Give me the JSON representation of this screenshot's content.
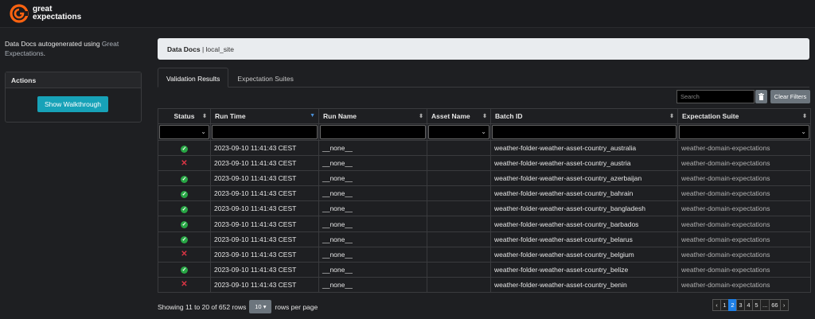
{
  "app": {
    "brand_line1": "great",
    "brand_line2": "expectations"
  },
  "sidebar": {
    "intro_text": "Data Docs autogenerated using ",
    "intro_link": "Great Expectations",
    "intro_end": ".",
    "actions_title": "Actions",
    "walkthrough_button": "Show Walkthrough"
  },
  "breadcrumb": {
    "root": "Data Docs",
    "separator": " | ",
    "site": "local_site"
  },
  "tabs": [
    {
      "label": "Validation Results",
      "active": true
    },
    {
      "label": "Expectation Suites",
      "active": false
    }
  ],
  "toolbar": {
    "search_placeholder": "Search",
    "clear_filters": "Clear Filters"
  },
  "table": {
    "columns": [
      "Status",
      "Run Time",
      "Run Name",
      "Asset Name",
      "Batch ID",
      "Expectation Suite"
    ],
    "rows": [
      {
        "status": "success",
        "run_time": "2023-09-10 11:41:43 CEST",
        "run_name": "__none__",
        "asset_name": "",
        "batch_id": "weather-folder-weather-asset-country_australia",
        "suite": "weather-domain-expectations"
      },
      {
        "status": "failed",
        "run_time": "2023-09-10 11:41:43 CEST",
        "run_name": "__none__",
        "asset_name": "",
        "batch_id": "weather-folder-weather-asset-country_austria",
        "suite": "weather-domain-expectations"
      },
      {
        "status": "success",
        "run_time": "2023-09-10 11:41:43 CEST",
        "run_name": "__none__",
        "asset_name": "",
        "batch_id": "weather-folder-weather-asset-country_azerbaijan",
        "suite": "weather-domain-expectations"
      },
      {
        "status": "success",
        "run_time": "2023-09-10 11:41:43 CEST",
        "run_name": "__none__",
        "asset_name": "",
        "batch_id": "weather-folder-weather-asset-country_bahrain",
        "suite": "weather-domain-expectations"
      },
      {
        "status": "success",
        "run_time": "2023-09-10 11:41:43 CEST",
        "run_name": "__none__",
        "asset_name": "",
        "batch_id": "weather-folder-weather-asset-country_bangladesh",
        "suite": "weather-domain-expectations"
      },
      {
        "status": "success",
        "run_time": "2023-09-10 11:41:43 CEST",
        "run_name": "__none__",
        "asset_name": "",
        "batch_id": "weather-folder-weather-asset-country_barbados",
        "suite": "weather-domain-expectations"
      },
      {
        "status": "success",
        "run_time": "2023-09-10 11:41:43 CEST",
        "run_name": "__none__",
        "asset_name": "",
        "batch_id": "weather-folder-weather-asset-country_belarus",
        "suite": "weather-domain-expectations"
      },
      {
        "status": "failed",
        "run_time": "2023-09-10 11:41:43 CEST",
        "run_name": "__none__",
        "asset_name": "",
        "batch_id": "weather-folder-weather-asset-country_belgium",
        "suite": "weather-domain-expectations"
      },
      {
        "status": "success",
        "run_time": "2023-09-10 11:41:43 CEST",
        "run_name": "__none__",
        "asset_name": "",
        "batch_id": "weather-folder-weather-asset-country_belize",
        "suite": "weather-domain-expectations"
      },
      {
        "status": "failed",
        "run_time": "2023-09-10 11:41:43 CEST",
        "run_name": "__none__",
        "asset_name": "",
        "batch_id": "weather-folder-weather-asset-country_benin",
        "suite": "weather-domain-expectations"
      }
    ]
  },
  "footer": {
    "showing": "Showing 11 to 20 of 652 rows",
    "page_size": "10",
    "rows_per_page": "rows per page",
    "pages": [
      "‹",
      "1",
      "2",
      "3",
      "4",
      "5",
      "...",
      "66",
      "›"
    ],
    "active_page": "2"
  },
  "colors": {
    "accent": "#17a2b8",
    "brand_orange": "#ff6310",
    "success": "#28a745",
    "failure": "#dc3545",
    "active_page": "#1e7fe6"
  }
}
